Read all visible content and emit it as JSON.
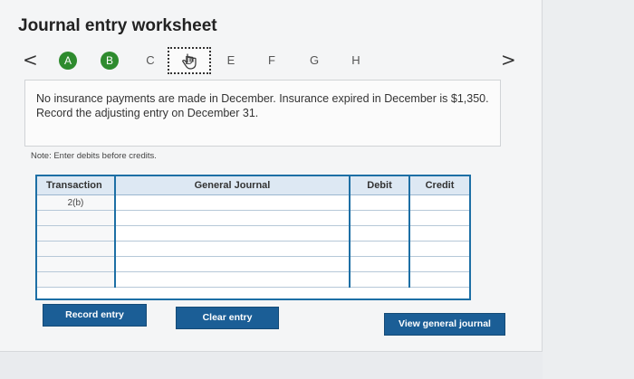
{
  "page": {
    "title": "Journal entry worksheet"
  },
  "nav": {
    "prev_symbol": "<",
    "next_symbol": ">",
    "steps": [
      {
        "label": "A",
        "state": "complete"
      },
      {
        "label": "B",
        "state": "complete"
      },
      {
        "label": "C",
        "state": "pending"
      },
      {
        "label": "D",
        "state": "current"
      },
      {
        "label": "E",
        "state": "pending"
      },
      {
        "label": "F",
        "state": "pending"
      },
      {
        "label": "G",
        "state": "pending"
      },
      {
        "label": "H",
        "state": "pending"
      }
    ]
  },
  "prompt": {
    "text": "No insurance payments are made in December. Insurance expired in December is $1,350. Record the adjusting entry on December 31."
  },
  "note": "Note: Enter debits before credits.",
  "journal": {
    "headers": {
      "transaction": "Transaction",
      "general_journal": "General Journal",
      "debit": "Debit",
      "credit": "Credit"
    },
    "transaction_value": "2(b)",
    "rows": [
      {
        "account": "",
        "debit": "",
        "credit": ""
      },
      {
        "account": "",
        "debit": "",
        "credit": ""
      },
      {
        "account": "",
        "debit": "",
        "credit": ""
      },
      {
        "account": "",
        "debit": "",
        "credit": ""
      },
      {
        "account": "",
        "debit": "",
        "credit": ""
      },
      {
        "account": "",
        "debit": "",
        "credit": ""
      }
    ]
  },
  "buttons": {
    "record": "Record entry",
    "clear": "Clear entry",
    "view": "View general journal"
  },
  "colors": {
    "complete": "#2e8b2e",
    "accent": "#1b5e96",
    "grid": "#1d6fa5"
  }
}
